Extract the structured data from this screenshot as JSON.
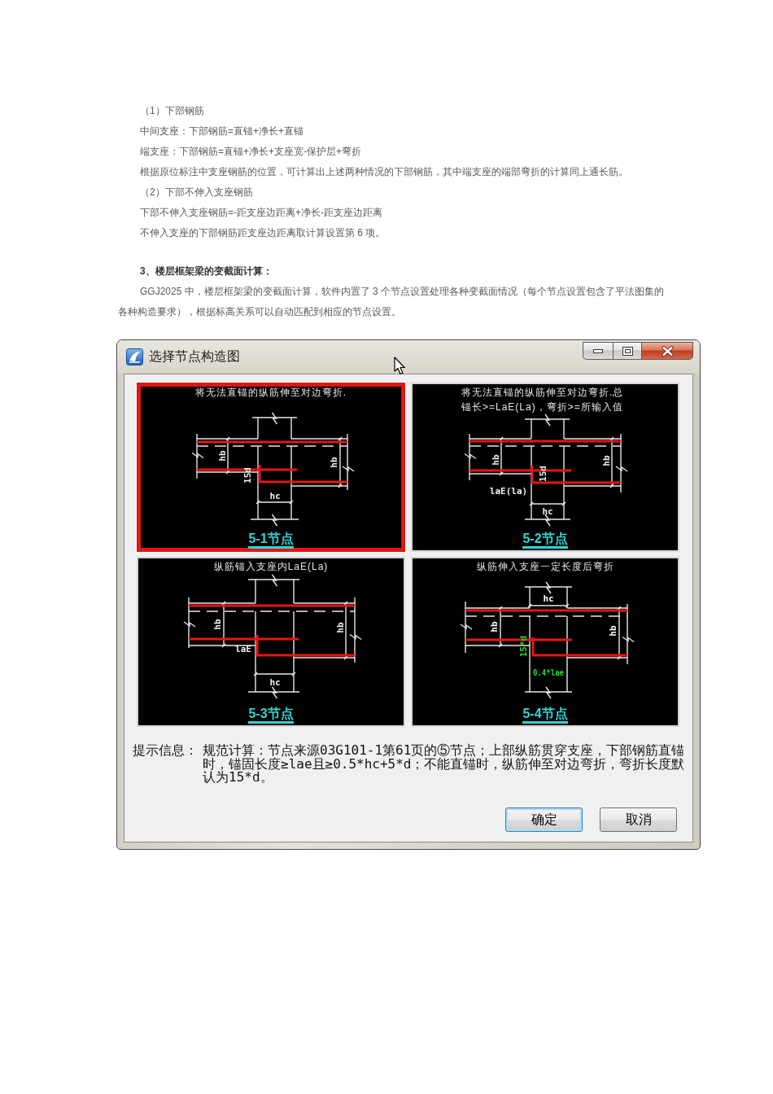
{
  "article": {
    "blocks": [
      {
        "kind": "paragraph",
        "text": "（1）下部钢筋"
      },
      {
        "kind": "paragraph",
        "text": "中间支座：下部钢筋=直锚+净长+直锚"
      },
      {
        "kind": "paragraph",
        "text": "端支座：下部钢筋=直锚+净长+支座宽-保护层+弯折"
      },
      {
        "kind": "paragraph",
        "text": "根据原位标注中支座钢筋的位置，可计算出上述两种情况的下部钢筋，其中端支座的端部弯折的计算同上通长筋。"
      },
      {
        "kind": "paragraph",
        "text": "（2）下部不伸入支座钢筋"
      },
      {
        "kind": "paragraph",
        "text": "下部不伸入支座钢筋=-距支座边距离+净长-距支座边距离"
      },
      {
        "kind": "paragraph",
        "text": "不伸入支座的下部钢筋距支座边距离取计算设置第 6 项。"
      },
      {
        "kind": "heading",
        "text": "3、楼层框架梁的变截面计算："
      },
      {
        "kind": "paragraph",
        "text": "GGJ2025 中，楼层框架梁的变截面计算，软件内置了 3 个节点设置处理各种变截面情况（每个节点设置包含了平法图集的各种构造要求），根据标高关系可以自动匹配到相应的节点设置。"
      }
    ]
  },
  "dialog": {
    "title": "选择节点构造图",
    "options": [
      {
        "kind": "bend-to-far-side",
        "selected": true,
        "caption": "将无法直锚的纵筋伸至对边弯折.",
        "labels": [
          {
            "text": "hb"
          },
          {
            "text": "hb"
          },
          {
            "text": "15d"
          },
          {
            "text": "hc"
          }
        ],
        "node": "5-1节点"
      },
      {
        "kind": "anchor-and-bend",
        "selected": false,
        "caption": "将无法直锚的纵筋伸至对边弯折.总锚长>=LaE(La)，弯折>=所输入值",
        "labels": [
          {
            "text": "hb"
          },
          {
            "text": "hb"
          },
          {
            "text": "15d"
          },
          {
            "text": "laE(la)"
          },
          {
            "text": "hc"
          }
        ],
        "node": "5-2节点"
      },
      {
        "kind": "straight-anchor",
        "selected": false,
        "caption": "纵筋锚入支座内LaE(La)",
        "labels": [
          {
            "text": "hb"
          },
          {
            "text": "hb"
          },
          {
            "text": "laE"
          },
          {
            "text": "hc"
          }
        ],
        "node": "5-3节点"
      },
      {
        "kind": "partial-bend",
        "selected": false,
        "caption": "纵筋伸入支座一定长度后弯折",
        "labels": [
          {
            "text": "hc",
            "color": "#ffffff"
          },
          {
            "text": "hb",
            "color": "#ffffff"
          },
          {
            "text": "hb",
            "color": "#ffffff"
          },
          {
            "text": "15*d",
            "color": "#22dd22"
          },
          {
            "text": "0.4*lae",
            "color": "#22dd22"
          }
        ],
        "node": "5-4节点"
      }
    ],
    "hint": {
      "label": "提示信息：",
      "text": "规范计算：节点来源03G101-1第61页的⑤节点；上部纵筋贯穿支座，下部钢筋直锚时，锚固长度≥lae且≥0.5*hc+5*d；不能直锚时，纵筋伸至对边弯折，弯折长度默认为15*d。"
    },
    "buttons": [
      {
        "label": "确定",
        "default": true
      },
      {
        "label": "取消",
        "default": false
      }
    ]
  }
}
